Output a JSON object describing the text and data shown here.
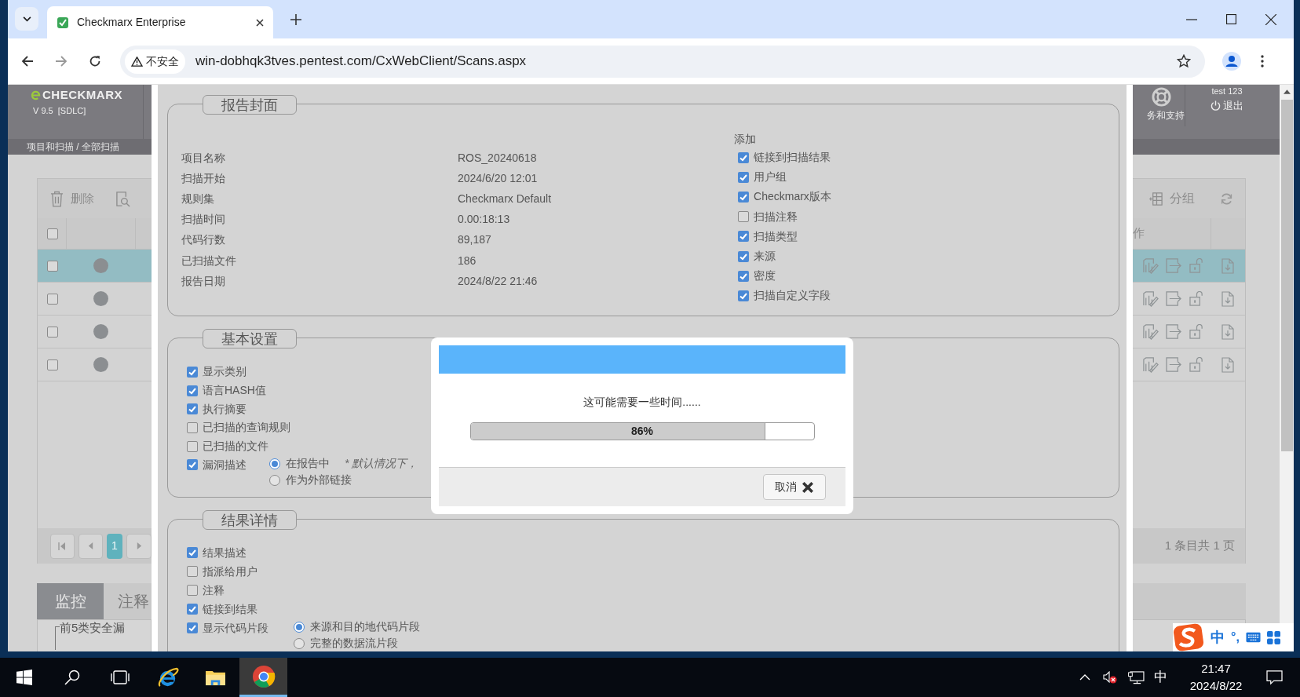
{
  "browser": {
    "tab": {
      "title": "Checkmarx Enterprise"
    },
    "address_bar": {
      "security_label": "不安全",
      "url": "win-dobhqk3tves.pentest.com/CxWebClient/Scans.aspx"
    }
  },
  "app": {
    "logo_text": "CHECKMARX",
    "version": "V 9.5  [SDLC]",
    "breadcrumb": "项目和扫描 / 全部扫描",
    "support_label": "务和支持",
    "user": "test 123",
    "logout": "退出",
    "toolbar": {
      "delete": "删除",
      "group": "分组"
    },
    "grid": {
      "select_all_checked": false,
      "header_partial": "作",
      "rows": [
        {
          "selected": true,
          "checked": false
        },
        {
          "selected": false,
          "checked": false
        },
        {
          "selected": false,
          "checked": false
        },
        {
          "selected": false,
          "checked": false
        }
      ]
    },
    "pager": {
      "page": "1",
      "summary": "1 条目共 1 页"
    },
    "tabs": [
      {
        "label": "监控",
        "selected": true
      },
      {
        "label": "注释",
        "selected": false
      }
    ],
    "panel_title": "前5类安全漏"
  },
  "report": {
    "cover": {
      "legend": "报告封面",
      "fields": [
        {
          "label": "项目名称",
          "value": "ROS_20240618"
        },
        {
          "label": "扫描开始",
          "value": "2024/6/20 12:01"
        },
        {
          "label": "规则集",
          "value": "Checkmarx Default"
        },
        {
          "label": "扫描时间",
          "value": "0.00:18:13"
        },
        {
          "label": "代码行数",
          "value": "89,187"
        },
        {
          "label": "已扫描文件",
          "value": "186"
        },
        {
          "label": "报告日期",
          "value": "2024/8/22 21:46"
        }
      ],
      "add_label": "添加",
      "add_options": [
        {
          "label": "链接到扫描结果",
          "checked": true
        },
        {
          "label": "用户组",
          "checked": true
        },
        {
          "label": "Checkmarx版本",
          "checked": true
        },
        {
          "label": "扫描注释",
          "checked": false
        },
        {
          "label": "扫描类型",
          "checked": true
        },
        {
          "label": "来源",
          "checked": true
        },
        {
          "label": "密度",
          "checked": true
        },
        {
          "label": "扫描自定义字段",
          "checked": true
        }
      ]
    },
    "sections": [
      {
        "legend": "基本设置",
        "options": [
          {
            "label": "显示类别",
            "checked": true
          },
          {
            "label": "语言HASH值",
            "checked": true
          },
          {
            "label": "执行摘要",
            "checked": true
          },
          {
            "label": "已扫描的查询规则",
            "checked": false
          },
          {
            "label": "已扫描的文件",
            "checked": false
          },
          {
            "label": "漏洞描述",
            "checked": true,
            "radios": [
              {
                "label": "在报告中",
                "selected": true,
                "note": "* 默认情况下，"
              },
              {
                "label": "作为外部链接",
                "selected": false
              }
            ]
          }
        ]
      },
      {
        "legend": "结果详情",
        "options": [
          {
            "label": "结果描述",
            "checked": true
          },
          {
            "label": "指派给用户",
            "checked": false
          },
          {
            "label": "注释",
            "checked": false
          },
          {
            "label": "链接到结果",
            "checked": true
          },
          {
            "label": "显示代码片段",
            "checked": true,
            "radios": [
              {
                "label": "来源和目的地代码片段",
                "selected": true
              },
              {
                "label": "完整的数据流片段",
                "selected": false
              }
            ]
          }
        ]
      }
    ]
  },
  "dialog": {
    "message": "这可能需要一些时间......",
    "progress": {
      "level": 0.86,
      "reading": "86%"
    },
    "cancel": "取消"
  },
  "taskbar": {
    "items": [
      {
        "kind": "start",
        "active": false
      },
      {
        "kind": "search",
        "active": false
      },
      {
        "kind": "taskview",
        "active": false
      },
      {
        "kind": "ie",
        "active": false
      },
      {
        "kind": "explorer",
        "active": false
      },
      {
        "kind": "chrome",
        "active": true
      }
    ],
    "ime_indicator": "中",
    "time": "21:47",
    "date": "2024/8/22"
  },
  "ime_bar": {
    "mode": "中",
    "punctuation": "°,"
  }
}
